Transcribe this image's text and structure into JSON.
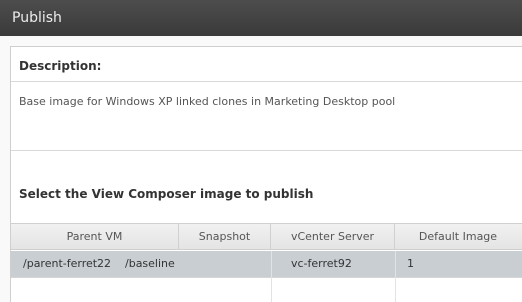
{
  "window": {
    "title": "Publish"
  },
  "description": {
    "label": "Description:",
    "text": "Base image for Windows XP linked clones in Marketing Desktop pool"
  },
  "image_section": {
    "label": "Select the View Composer image to publish"
  },
  "table": {
    "columns": [
      "Parent VM",
      "Snapshot",
      "vCenter Server",
      "Default Image"
    ],
    "rows": [
      {
        "parent_vm": "/parent-ferret22",
        "snapshot": "/baseline",
        "vcenter_server": "vc-ferret92",
        "default_image": "1",
        "selected": true
      }
    ]
  }
}
